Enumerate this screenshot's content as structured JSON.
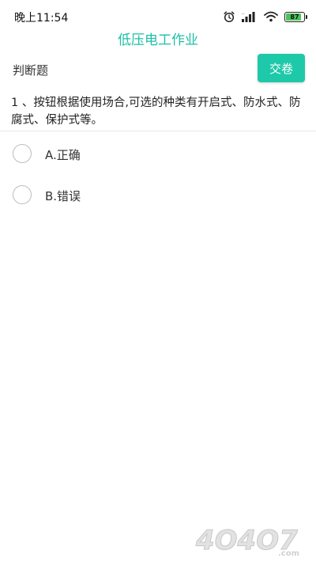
{
  "status_bar": {
    "time": "晚上11:54",
    "battery_level": "87",
    "icons": [
      "alarm-icon",
      "signal-icon",
      "wifi-icon",
      "battery-icon"
    ],
    "battery_color": "#4ac45a"
  },
  "header": {
    "title": "低压电工作业",
    "title_color": "#1dbfa6"
  },
  "section": {
    "label": "判断题",
    "submit_label": "交卷",
    "submit_color": "#1ec9a9"
  },
  "question": {
    "text": "1 、按钮根据使用场合,可选的种类有开启式、防水式、防腐式、保护式等。",
    "options": [
      {
        "label": "A.正确"
      },
      {
        "label": "B.错误"
      }
    ]
  },
  "watermark": {
    "text": "4O4O7.com"
  }
}
